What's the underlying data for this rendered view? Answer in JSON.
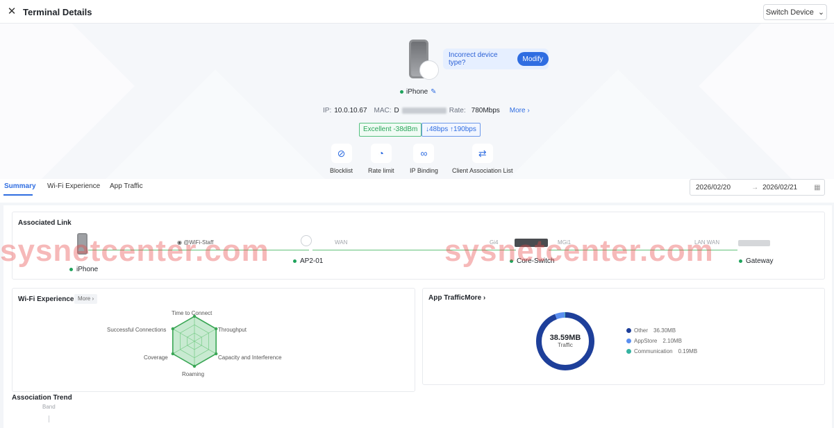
{
  "header": {
    "title": "Terminal Details",
    "switch_label": "Switch Device"
  },
  "device": {
    "name": "iPhone",
    "incorrect_text": "Incorrect device type?",
    "modify_label": "Modify",
    "ip_label": "IP:",
    "ip_value": "10.0.10.67",
    "mac_label": "MAC:",
    "mac_value": "D",
    "rate_label": "Rate:",
    "rate_value": "780Mbps",
    "more_label": "More",
    "signal_badge": "Excellent -38dBm",
    "rate_badge": "↓48bps ↑190bps"
  },
  "actions": [
    {
      "label": "Blocklist",
      "icon": "user-block-icon"
    },
    {
      "label": "Rate limit",
      "icon": "gauge-icon"
    },
    {
      "label": "IP Binding",
      "icon": "link-icon"
    },
    {
      "label": "Client Association List",
      "icon": "association-list-icon"
    }
  ],
  "tabs": [
    {
      "label": "Summary",
      "active": true
    },
    {
      "label": "Wi-Fi Experience",
      "active": false
    },
    {
      "label": "App Traffic",
      "active": false
    }
  ],
  "date_range": {
    "start": "2026/02/20",
    "end": "2026/02/21"
  },
  "associated_link": {
    "title": "Associated Link",
    "ssid": "@WiFi-Staff",
    "nodes": [
      "iPhone",
      "AP2-01",
      "Core-Switch",
      "Gateway"
    ],
    "port_labels": [
      "WAN",
      "Gi4",
      "MGi1",
      "LAN WAN"
    ]
  },
  "wifi_experience": {
    "title": "Wi-Fi Experience",
    "more_label": "More",
    "axes": [
      "Time to Connect",
      "Throughput",
      "Capacity and Interference",
      "Roaming",
      "Coverage",
      "Successful Connections"
    ],
    "scores": [
      1,
      1,
      1,
      1,
      1,
      1
    ]
  },
  "app_traffic": {
    "title": "App Traffic",
    "more_label": "More",
    "total": "38.59MB",
    "total_label": "Traffic",
    "items": [
      {
        "name": "Other",
        "value": "36.30MB",
        "mb": 36.3,
        "color": "#1e3f9a"
      },
      {
        "name": "AppStore",
        "value": "2.10MB",
        "mb": 2.1,
        "color": "#5b8ff0"
      },
      {
        "name": "Communication",
        "value": "0.19MB",
        "mb": 0.19,
        "color": "#36b3a1"
      }
    ]
  },
  "association_trend": {
    "title": "Association Trend",
    "band_label": "Band"
  },
  "watermark": "sysnetcenter.com"
}
